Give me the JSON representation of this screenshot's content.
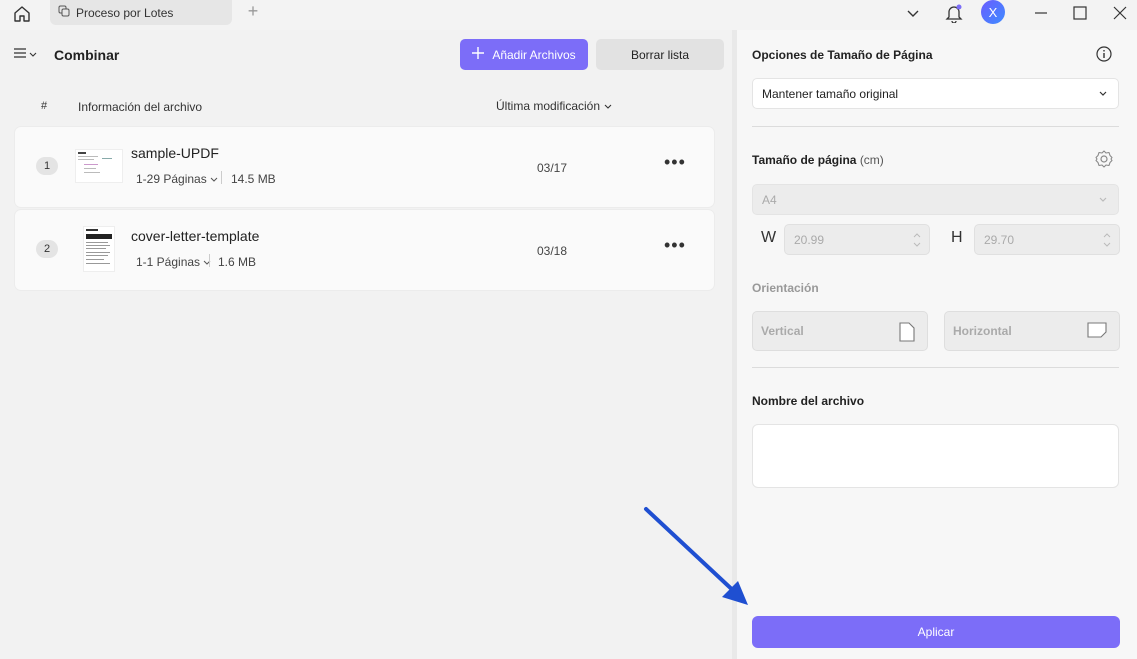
{
  "titlebar": {
    "tab_label": "Proceso por Lotes",
    "avatar_letter": "X"
  },
  "toolbar": {
    "title": "Combinar",
    "add_files_label": "Añadir Archivos",
    "clear_list_label": "Borrar lista"
  },
  "table": {
    "col_number": "#",
    "col_info": "Información del archivo",
    "col_modified": "Última modificación",
    "rows": [
      {
        "index": "1",
        "name": "sample-UPDF",
        "pages": "1-29 Páginas",
        "size": "14.5 MB",
        "date": "03/17"
      },
      {
        "index": "2",
        "name": "cover-letter-template",
        "pages": "1-1 Páginas",
        "size": "1.6 MB",
        "date": "03/18"
      }
    ]
  },
  "options": {
    "page_size_options_label": "Opciones de Tamaño de Página",
    "page_size_mode": "Mantener tamaño original",
    "page_size_label": "Tamaño de página",
    "page_size_unit": "(cm)",
    "paper": "A4",
    "width_letter": "W",
    "width_value": "20.99",
    "height_letter": "H",
    "height_value": "29.70",
    "orientation_label": "Orientación",
    "vertical_label": "Vertical",
    "horizontal_label": "Horizontal",
    "filename_label": "Nombre del archivo",
    "filename_value": "",
    "apply_label": "Aplicar"
  },
  "colors": {
    "accent": "#7c6df8",
    "annotation_arrow": "#1f4fd1"
  }
}
